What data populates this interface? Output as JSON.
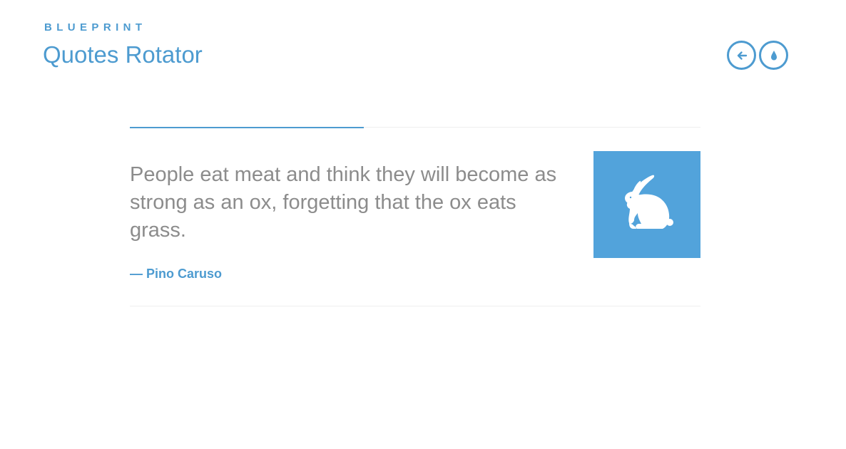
{
  "header": {
    "brand": "BLUEPRINT",
    "title": "Quotes Rotator"
  },
  "nav": {
    "icons": [
      "arrow-left-circle-icon",
      "water-drop-circle-icon"
    ]
  },
  "rotator": {
    "progress_fraction": 0.41,
    "quote": {
      "text": "People eat meat and think they will become as strong as an ox, forgetting that the ox eats grass.",
      "author": "— Pino Caruso",
      "image_icon": "rabbit-icon"
    }
  },
  "colors": {
    "accent": "#4d9bd0",
    "image_bg": "#52a3db",
    "quote_text": "#8c8c8c",
    "rule": "#eeeeee"
  }
}
